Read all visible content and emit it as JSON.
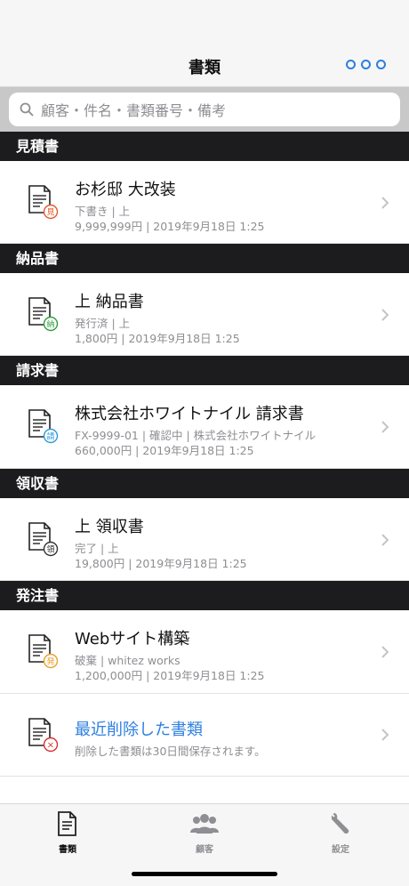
{
  "nav": {
    "title": "書類",
    "more_icon": "more-circles-icon",
    "accent": "#2d7fe0"
  },
  "search": {
    "placeholder": "顧客・件名・書類番号・備考"
  },
  "sections": [
    {
      "header": "見積書",
      "item": {
        "title": "お杉邸 大改装",
        "sub1": "下書き | 上",
        "sub2": "9,999,999円 | 2019年9月18日 1:25",
        "badge": "見",
        "badge_color": "#e05a2b"
      }
    },
    {
      "header": "納品書",
      "item": {
        "title": "上 納品書",
        "sub1": "発行済 | 上",
        "sub2": "1,800円 | 2019年9月18日 1:25",
        "badge": "納",
        "badge_color": "#2f9d3c"
      }
    },
    {
      "header": "請求書",
      "item": {
        "title": "株式会社ホワイトナイル 請求書",
        "sub1": "FX-9999-01 | 確認中 | 株式会社ホワイトナイル",
        "sub2": "660,000円 | 2019年9月18日 1:25",
        "badge": "請",
        "badge_color": "#2d9ad8"
      }
    },
    {
      "header": "領収書",
      "item": {
        "title": "上 領収書",
        "sub1": "完了 | 上",
        "sub2": "19,800円 | 2019年9月18日 1:25",
        "badge": "領",
        "badge_color": "#333333"
      }
    },
    {
      "header": "発注書",
      "item": {
        "title": "Webサイト構築",
        "sub1": "破棄 | whitez works",
        "sub2": "1,200,000円 | 2019年9月18日 1:25",
        "badge": "発",
        "badge_color": "#e8a12a"
      }
    }
  ],
  "deleted": {
    "title": "最近削除した書類",
    "sub": "削除した書類は30日間保存されます。",
    "badge": "×",
    "badge_color": "#d93030"
  },
  "tabs": [
    {
      "label": "書類",
      "icon": "document-icon",
      "active": true
    },
    {
      "label": "顧客",
      "icon": "people-icon",
      "active": false
    },
    {
      "label": "設定",
      "icon": "wrench-icon",
      "active": false
    }
  ]
}
